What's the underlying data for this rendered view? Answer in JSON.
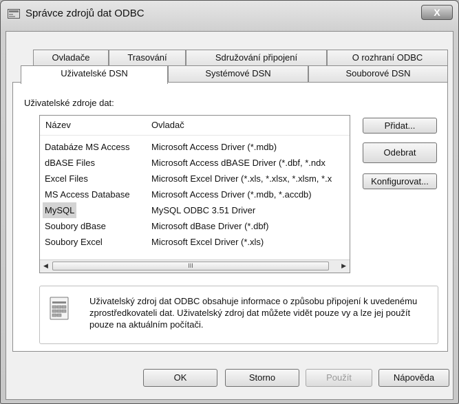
{
  "window": {
    "title": "Správce zdrojů dat ODBC",
    "close_glyph": "X"
  },
  "tabs": {
    "back_row": [
      "Ovladače",
      "Trasování",
      "Sdružování připojení",
      "O rozhraní ODBC"
    ],
    "front_row": [
      "Uživatelské DSN",
      "Systémové DSN",
      "Souborové DSN"
    ],
    "active": "Uživatelské DSN"
  },
  "panel": {
    "sources_label": "Uživatelské zdroje dat:",
    "columns": [
      "Název",
      "Ovladač"
    ],
    "rows": [
      {
        "name": "Databáze MS Access",
        "driver": "Microsoft Access Driver (*.mdb)"
      },
      {
        "name": "dBASE Files",
        "driver": "Microsoft Access dBASE Driver (*.dbf, *.ndx"
      },
      {
        "name": "Excel Files",
        "driver": "Microsoft Excel Driver (*.xls, *.xlsx, *.xlsm, *.x"
      },
      {
        "name": "MS Access Database",
        "driver": "Microsoft Access Driver (*.mdb, *.accdb)"
      },
      {
        "name": "MySQL",
        "driver": "MySQL ODBC 3.51 Driver"
      },
      {
        "name": "Soubory dBase",
        "driver": "Microsoft dBase Driver (*.dbf)"
      },
      {
        "name": "Soubory Excel",
        "driver": "Microsoft Excel Driver (*.xls)"
      }
    ],
    "selected_row": "MySQL",
    "scroll_thumb_grip": "III",
    "side_buttons": {
      "add": "Přidat...",
      "remove": "Odebrat",
      "configure": "Konfigurovat..."
    },
    "info_text": "Uživatelský zdroj dat ODBC obsahuje informace o způsobu připojení k uvedenému zprostředkovateli dat. Uživatelský zdroj dat můžete vidět pouze vy a lze jej použít pouze na aktuálním počítači."
  },
  "footer": {
    "ok": "OK",
    "cancel": "Storno",
    "apply": "Použít",
    "help": "Nápověda"
  },
  "icons": [
    "window-app-icon",
    "close-icon",
    "info-document-icon",
    "scroll-left-icon",
    "scroll-right-icon"
  ]
}
